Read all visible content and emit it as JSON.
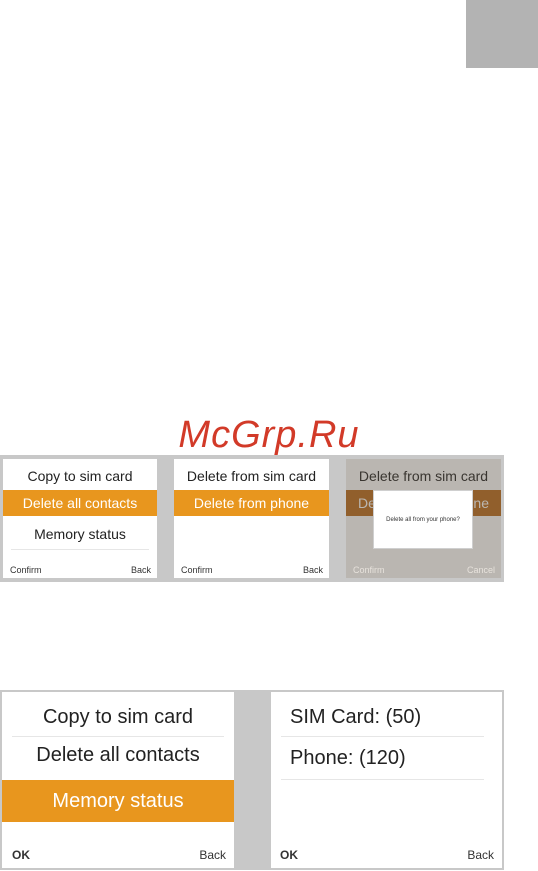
{
  "watermark": "McGrp.Ru",
  "top_row": {
    "screen1": {
      "items": [
        "Copy to sim card",
        "Delete all contacts",
        "Memory status"
      ],
      "selected_index": 1,
      "left_soft": "Confirm",
      "right_soft": "Back"
    },
    "screen2": {
      "items": [
        "Delete from sim card",
        "Delete from phone"
      ],
      "selected_index": 1,
      "left_soft": "Confirm",
      "right_soft": "Back"
    },
    "screen3": {
      "title": "Delete from sim card",
      "selected_partial_left": "De",
      "selected_partial_right": "ne",
      "dialog_text": "Delete all from your phone?",
      "left_soft": "Confirm",
      "right_soft": "Cancel"
    }
  },
  "bottom_row": {
    "screen1": {
      "items": [
        "Copy to sim card",
        "Delete all contacts",
        "Memory status"
      ],
      "selected_index": 2,
      "left_soft": "OK",
      "right_soft": "Back"
    },
    "screen2": {
      "items": [
        "SIM Card: (50)",
        "Phone: (120)"
      ],
      "left_soft": "OK",
      "right_soft": "Back"
    }
  },
  "colors": {
    "highlight": "#e8961e",
    "highlight_dim": "#b86a1a",
    "frame": "#c8c8c8",
    "watermark": "#d23a28"
  }
}
